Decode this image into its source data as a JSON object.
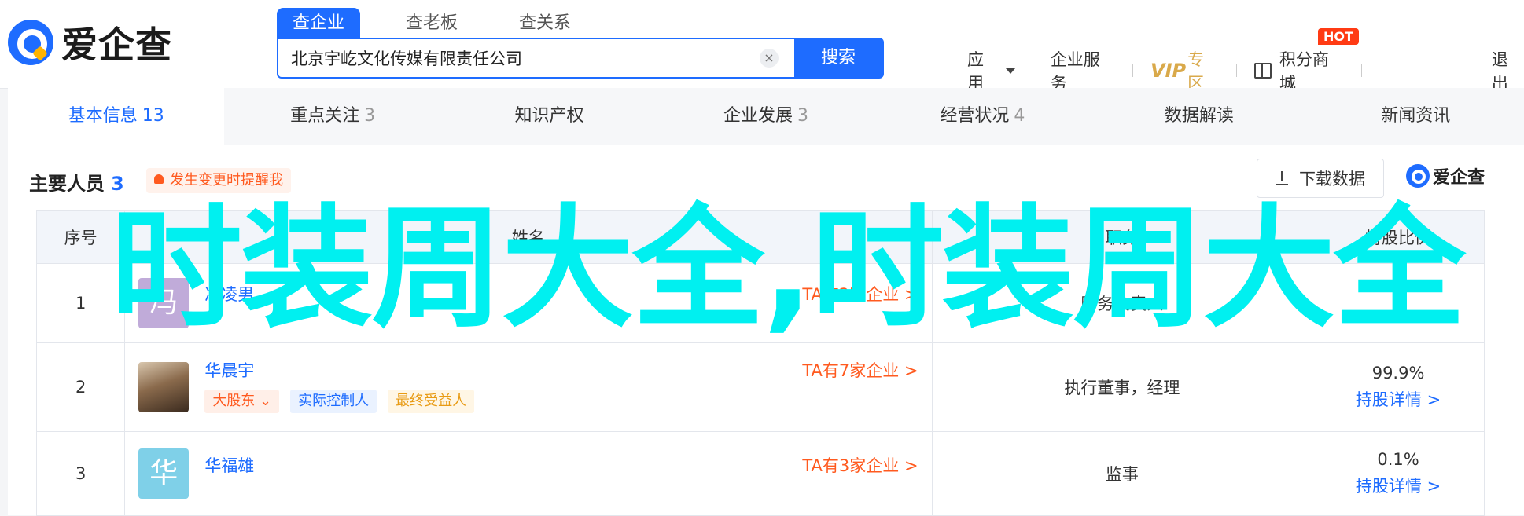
{
  "header": {
    "brand": "爱企查",
    "search_tabs": [
      "查企业",
      "查老板",
      "查关系"
    ],
    "search_value": "北京宇屹文化传媒有限责任公司",
    "clear_icon": "×",
    "search_button": "搜索",
    "nav": {
      "apps": "应用",
      "enterprise_service": "企业服务",
      "vip": "VIP",
      "vip_zone": "专区",
      "points_mall": "积分商城",
      "hot_badge": "HOT",
      "logout": "退出"
    }
  },
  "tabs": [
    {
      "label": "基本信息",
      "count": "13",
      "active": true
    },
    {
      "label": "重点关注",
      "count": "3"
    },
    {
      "label": "知识产权",
      "count": ""
    },
    {
      "label": "企业发展",
      "count": "3"
    },
    {
      "label": "经营状况",
      "count": "4"
    },
    {
      "label": "数据解读",
      "count": ""
    },
    {
      "label": "新闻资讯",
      "count": ""
    }
  ],
  "section": {
    "title": "主要人员",
    "count": "3",
    "alert": "发生变更时提醒我",
    "download": "下载数据",
    "brand": "爱企查"
  },
  "table": {
    "headers": [
      "序号",
      "姓名",
      "职务",
      "持股比例"
    ],
    "rows": [
      {
        "index": "1",
        "avatar_char": "冯",
        "name": "冯凌男",
        "link": "TA有2家企业 >",
        "role": "财务负责人",
        "share": "-",
        "share_link": ""
      },
      {
        "index": "2",
        "avatar_char": "",
        "name": "华晨宇",
        "link": "TA有7家企业 >",
        "tags": [
          "大股东",
          "实际控制人",
          "最终受益人"
        ],
        "role": "执行董事，经理",
        "share": "99.9%",
        "share_link": "持股详情 >"
      },
      {
        "index": "3",
        "avatar_char": "华",
        "name": "华福雄",
        "link": "TA有3家企业 >",
        "role": "监事",
        "share": "0.1%",
        "share_link": "持股详情 >"
      }
    ]
  },
  "overlay_text": "时装周大全,时装周大全",
  "colors": {
    "accent": "#1e6cff",
    "orange": "#ff5a1f",
    "overlay": "#00f0f0"
  }
}
